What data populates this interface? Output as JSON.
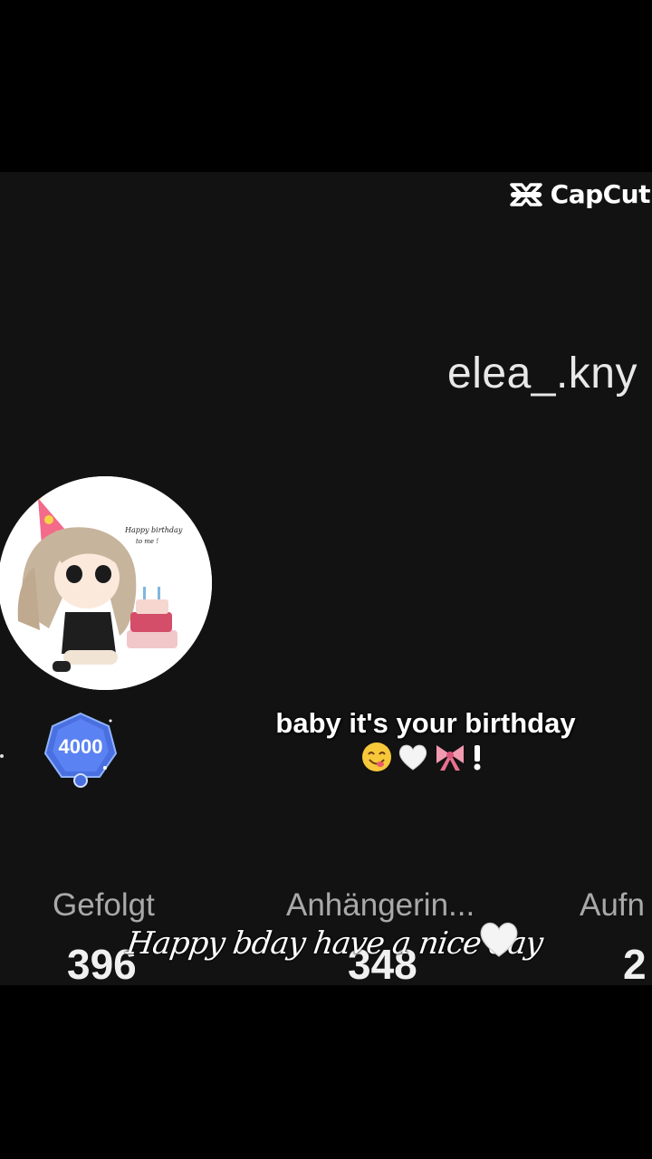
{
  "watermark": {
    "text": "CapCut",
    "icon": "capcut-logo-icon"
  },
  "profile": {
    "username": "elea_.kny",
    "badge_value": "4000",
    "avatar_text_line1": "Happy birthday",
    "avatar_text_line2": "to me !"
  },
  "caption": {
    "text": "baby it's your birthday",
    "emojis": [
      "smiling-face-icon",
      "white-heart-icon",
      "ribbon-icon",
      "exclamation-icon"
    ]
  },
  "stats": [
    {
      "label": "Gefolgt",
      "value": "396"
    },
    {
      "label": "Anhängerin...",
      "value": "348"
    },
    {
      "label": "Aufn",
      "value": "2"
    }
  ],
  "overlay_text": "Happy bday have a nice day",
  "colors": {
    "background": "#000000",
    "video_background": "#121212",
    "badge": "#4a6fe0"
  }
}
